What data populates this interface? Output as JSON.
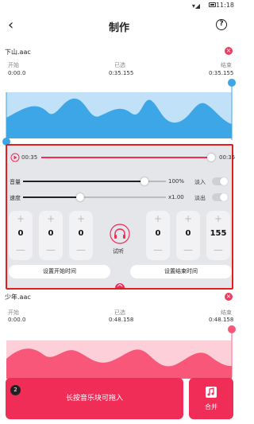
{
  "status": {
    "time": "11:18",
    "signal": "▾◢"
  },
  "header": {
    "title": "制作",
    "back_icon": "‹",
    "help_icon": "?"
  },
  "clip1": {
    "filename": "下山.aac",
    "start_label": "开始",
    "start_value": "0:00.0",
    "selected_label": "已选",
    "selected_value": "0:35.155",
    "end_label": "结束",
    "end_value": "0:35.155",
    "color": "#3da6e6"
  },
  "editor": {
    "play_time": "00:35",
    "end_time": "00:35",
    "volume_label": "音量",
    "volume_value": "100%",
    "volume_level": 0.85,
    "fadein_label": "淡入",
    "speed_label": "速度",
    "speed_value": "x1.00",
    "speed_level": 0.4,
    "fadeout_label": "淡出",
    "start_steppers": [
      {
        "plus": "+",
        "value": "0",
        "minus": "—"
      },
      {
        "plus": "+",
        "value": "0",
        "minus": "—"
      },
      {
        "plus": "+",
        "value": "0",
        "minus": "—"
      }
    ],
    "end_steppers": [
      {
        "plus": "+",
        "value": "0",
        "minus": "—"
      },
      {
        "plus": "+",
        "value": "0",
        "minus": "—"
      },
      {
        "plus": "+",
        "value": "155",
        "minus": "—"
      }
    ],
    "listen_label": "试听",
    "set_start_label": "设置开始时间",
    "set_end_label": "设置结束时间",
    "accent": "#ef2d57"
  },
  "clip2": {
    "filename": "少年.aac",
    "start_label": "开始",
    "start_value": "0:00.0",
    "selected_label": "已选",
    "selected_value": "0:48.158",
    "end_label": "结束",
    "end_value": "0:48.158",
    "color": "#f8577a"
  },
  "bottom": {
    "badge": "2",
    "drag_label": "长按音乐块可拖入",
    "merge_label": "合并"
  }
}
